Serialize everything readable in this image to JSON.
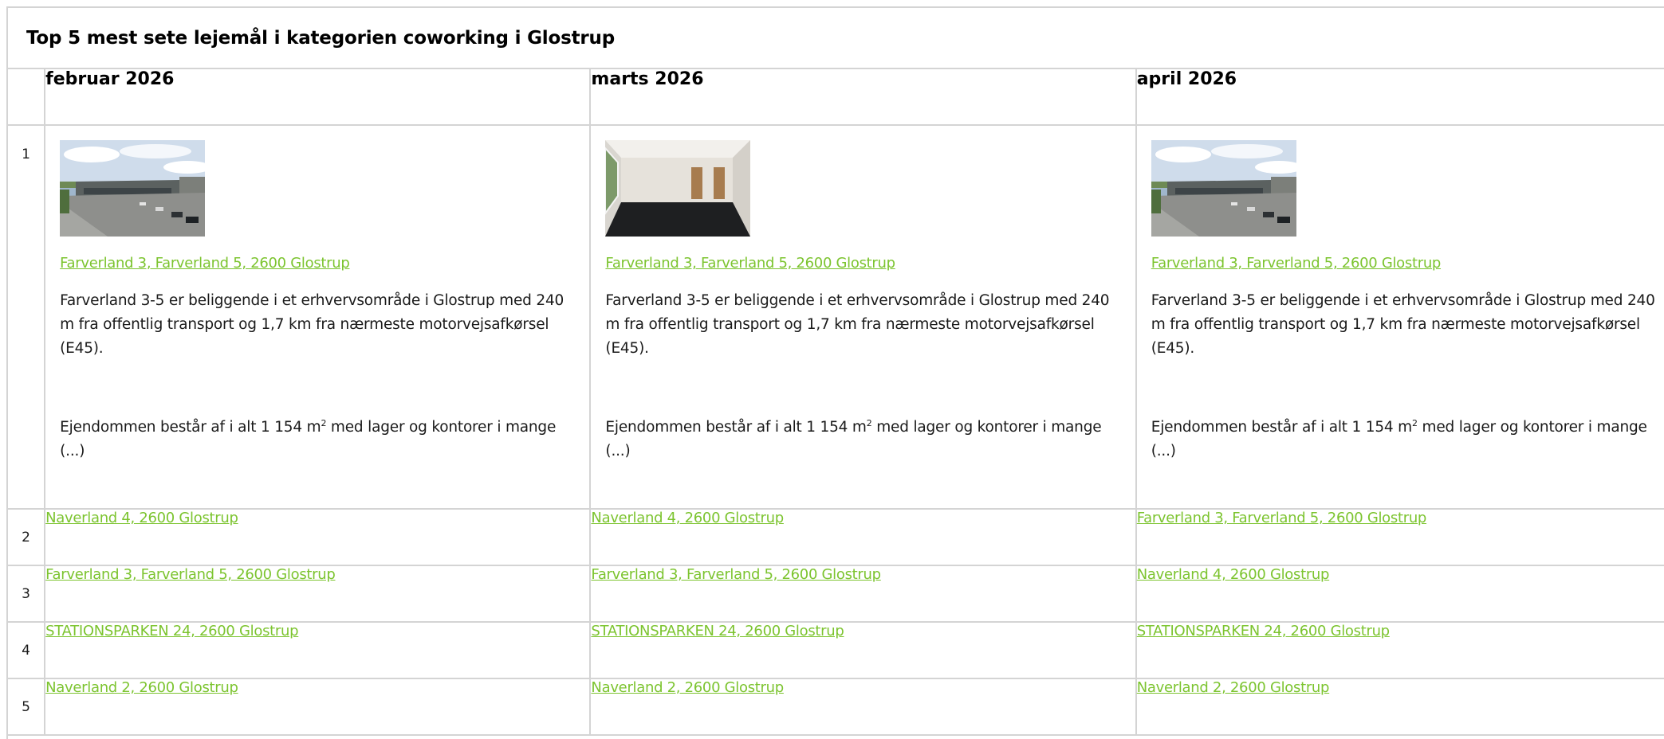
{
  "title": "Top 5 mest sete lejemål i kategorien coworking i Glostrup",
  "months": [
    "februar 2026",
    "marts 2026",
    "april 2026"
  ],
  "ranks": [
    "1",
    "2",
    "3",
    "4",
    "5"
  ],
  "top": [
    {
      "image": "industrial-building-photo",
      "address": "Farverland 3, Farverland 5, 2600 Glostrup",
      "desc1": "Farverland 3-5 er beliggende i et erhvervsområde i Glostrup med 240 m fra offentlig transport og 1,7 km fra nærmeste motorvejsafkørsel (E45).",
      "desc2_before": "Ejendommen består af i alt 1 154 m",
      "desc2_sup": "2",
      "desc2_after": " med lager og kontorer i mange (...)"
    },
    {
      "image": "empty-office-room-photo",
      "address": "Farverland 3, Farverland 5, 2600 Glostrup",
      "desc1": "Farverland 3-5 er beliggende i et erhvervsområde i Glostrup med 240 m fra offentlig transport og 1,7 km fra nærmeste motorvejsafkørsel (E45).",
      "desc2_before": "Ejendommen består af i alt 1 154 m",
      "desc2_sup": "2",
      "desc2_after": " med lager og kontorer i mange (...)"
    },
    {
      "image": "industrial-building-photo",
      "address": "Farverland 3, Farverland 5, 2600 Glostrup",
      "desc1": "Farverland 3-5 er beliggende i et erhvervsområde i Glostrup med 240 m fra offentlig transport og 1,7 km fra nærmeste motorvejsafkørsel (E45).",
      "desc2_before": "Ejendommen består af i alt 1 154 m",
      "desc2_sup": "2",
      "desc2_after": " med lager og kontorer i mange (...)"
    }
  ],
  "rows": [
    [
      "Naverland 4, 2600 Glostrup",
      "Naverland 4, 2600 Glostrup",
      "Farverland 3, Farverland 5, 2600 Glostrup"
    ],
    [
      "Farverland 3, Farverland 5, 2600 Glostrup",
      "Farverland 3, Farverland 5, 2600 Glostrup",
      "Naverland 4, 2600 Glostrup"
    ],
    [
      "STATIONSPARKEN 24, 2600 Glostrup",
      "STATIONSPARKEN 24, 2600 Glostrup",
      "STATIONSPARKEN 24, 2600 Glostrup"
    ],
    [
      "Naverland 2, 2600 Glostrup",
      "Naverland 2, 2600 Glostrup",
      "Naverland 2, 2600 Glostrup"
    ]
  ],
  "colors": {
    "link": "#7cc42f",
    "border": "#d4d4d4"
  }
}
